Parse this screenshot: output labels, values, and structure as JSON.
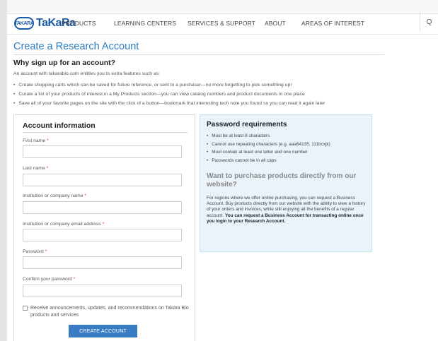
{
  "brand": {
    "logo_mark": "TAKARA",
    "logo_text": "TaKaRa"
  },
  "nav": {
    "items": [
      "PRODUCTS",
      "LEARNING CENTERS",
      "SERVICES & SUPPORT",
      "ABOUT",
      "AREAS OF INTEREST"
    ],
    "search_icon": "Q"
  },
  "page": {
    "title": "Create a Research Account",
    "why_heading": "Why sign up for an account?",
    "intro": "An account with takarabio.com entitles you to extra features such as:",
    "benefits": [
      "Create shopping carts which can be saved for future reference, or sent to a purchaser—no more forgetting to pick something up!",
      "Curate a list of your products of interest in a My Products section—you can view catalog numbers and product documents in one place",
      "Save all of your favorite pages on the site with the click of a button—bookmark that interesting tech note you found so you can read it again later"
    ]
  },
  "form": {
    "title": "Account information",
    "required_marker": "*",
    "fields": [
      {
        "label": "First name",
        "value": ""
      },
      {
        "label": "Last name",
        "value": ""
      },
      {
        "label": "Institution or company name",
        "value": ""
      },
      {
        "label": "Institution or company email address",
        "value": ""
      },
      {
        "label": "Password",
        "value": ""
      },
      {
        "label": "Confirm your password",
        "value": ""
      }
    ],
    "announcements_label": "Receive announcements, updates, and recommendations on Takara Bio products and services",
    "announcements_checked": false,
    "submit_label": "CREATE ACCOUNT"
  },
  "password": {
    "title": "Password requirements",
    "rules": [
      "Must be at least 8 characters",
      "Cannot use repeating characters (e.g. aaa64135, 111bcxjk)",
      "Must contain at least one letter and one number",
      "Passwords cannot be in all caps"
    ],
    "purchase_heading": "Want to purchase products directly from our website?",
    "purchase_text": "For regions where we offer online purchasing, you can request a Business Account. Buy products directly from our website with the ability to view a history of your orders and invoices, while still enjoying all the benefits of a regular account.",
    "purchase_bold": "You can request a Business Account for transacting online once you login to your Research Account."
  },
  "colors": {
    "brand": "#1b5aa8",
    "title": "#2d7dc1",
    "button": "#3a7cc4",
    "panel": "#e9f3f9",
    "required": "#dd3333"
  }
}
